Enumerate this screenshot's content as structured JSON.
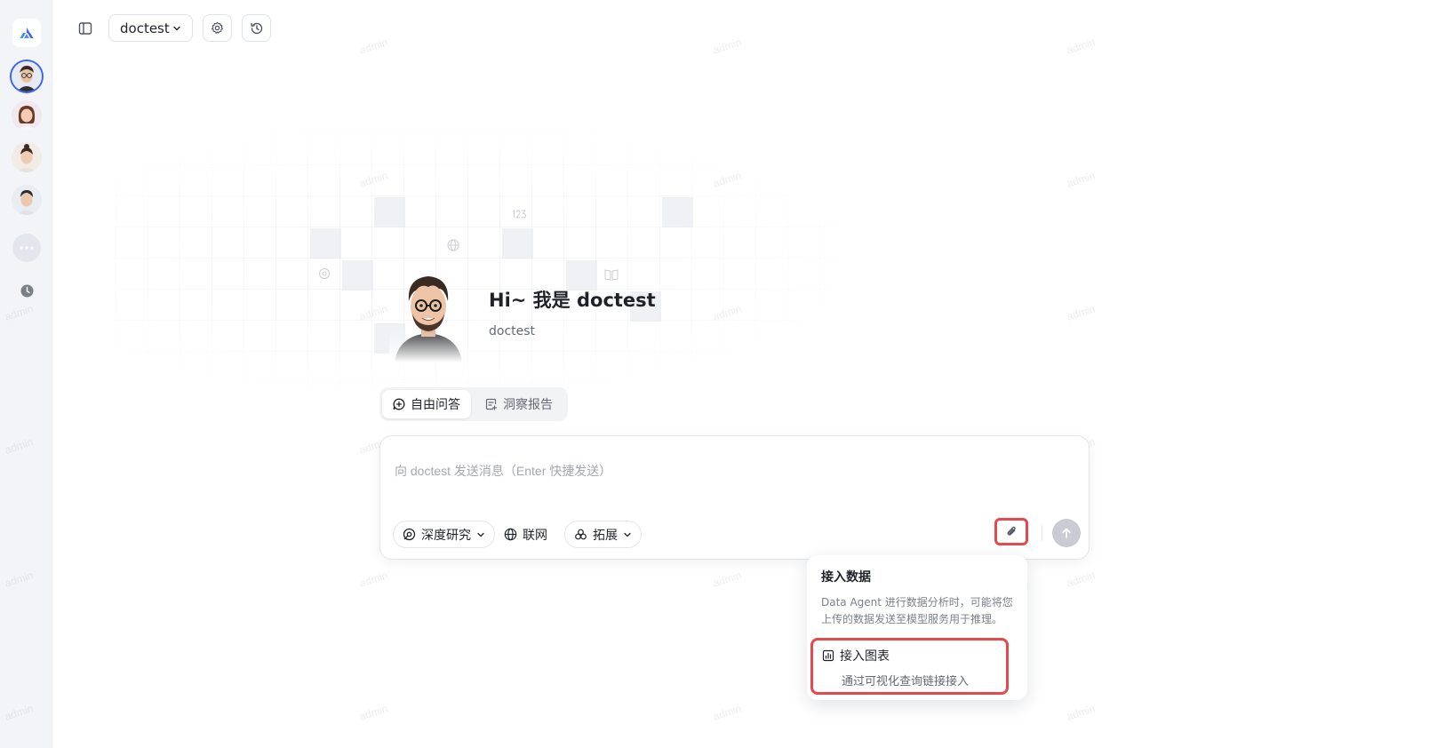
{
  "agent_selector": {
    "name": "doctest"
  },
  "hero": {
    "title": "Hi~ 我是 doctest",
    "subtitle": "doctest"
  },
  "mode_tabs": [
    {
      "label": "自由问答",
      "active": true
    },
    {
      "label": "洞察报告",
      "active": false
    }
  ],
  "composer": {
    "placeholder": "向 doctest 发送消息（Enter 快捷发送）",
    "tools": {
      "deep_research": "深度研究",
      "web": "联网",
      "extensions": "拓展"
    }
  },
  "attach_popover": {
    "title": "接入数据",
    "description": "Data Agent 进行数据分析时，可能将您上传的数据发送至模型服务用于推理。",
    "item_title": "接入图表",
    "item_description": "通过可视化查询链接接入"
  },
  "watermark": "admin",
  "colors": {
    "accent": "#3b63f3",
    "highlight_border": "#e5484d"
  },
  "icons": [
    "logo-icon",
    "panel-toggle-icon",
    "chevron-down-icon",
    "gear-icon",
    "history-icon",
    "more-icon",
    "clock-icon",
    "chat-icon",
    "report-icon",
    "deep-research-icon",
    "globe-icon",
    "extension-icon",
    "paperclip-icon",
    "arrow-up-icon",
    "chart-icon"
  ]
}
